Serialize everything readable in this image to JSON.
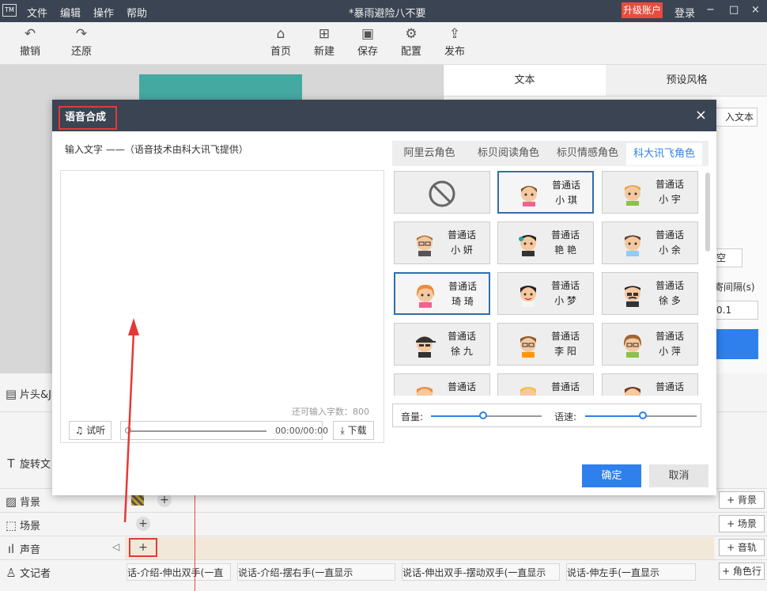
{
  "titlebar": {
    "logo": "TM",
    "menu": [
      "文件",
      "编辑",
      "操作",
      "帮助"
    ],
    "doc_title": "*暴雨避险八不要",
    "upgrade": "升级账户",
    "login": "登录",
    "window_controls": [
      "−",
      "□",
      "×"
    ]
  },
  "toolbar": {
    "undo": "撤销",
    "redo": "还原",
    "home": "首页",
    "new": "新建",
    "save": "保存",
    "config": "配置",
    "publish": "发布"
  },
  "right_panel": {
    "tab_text": "文本",
    "tab_preset": "预设风格",
    "import_partial": "入文本",
    "clear_partial": "空",
    "interval_partial": "寄间隔(s)",
    "interval_value": "0.1"
  },
  "timeline": {
    "header_partial": "片头&J",
    "rotate_partial": "旋转文",
    "rows": [
      {
        "label": "背景",
        "add": "+ 背景"
      },
      {
        "label": "场景",
        "add": "+ 场景"
      },
      {
        "label": "声音",
        "add": "+ 音轨"
      },
      {
        "label": "文记者",
        "add": "+ 角色行"
      }
    ],
    "clips": [
      "话-介绍-伸出双手(一直",
      "说话-介绍-摆右手(一直显示",
      "说话-伸出双手-摆动双手(一直显示",
      "说话-伸左手(一直显示"
    ]
  },
  "modal": {
    "title": "语音合成",
    "close": "×",
    "hint": "输入文字 ——（语音技术由科大讯飞提供）",
    "remaining": "还可输入字数：800",
    "listen": "试听",
    "time": "00:00/00:00",
    "download": "下载",
    "tabs": [
      "阿里云角色",
      "标贝阅读角色",
      "标贝情感角色",
      "科大讯飞角色"
    ],
    "active_tab": "科大讯飞角色",
    "voices": [
      {
        "line1": "",
        "line2": "",
        "type": "none"
      },
      {
        "line1": "普通话",
        "line2": "小 琪",
        "type": "girl"
      },
      {
        "line1": "普通话",
        "line2": "小 宇",
        "type": "boy"
      },
      {
        "line1": "普通话",
        "line2": "小 妍",
        "type": "woman-glasses"
      },
      {
        "line1": "普通话",
        "line2": "艳 艳",
        "type": "woman-mic"
      },
      {
        "line1": "普通话",
        "line2": "小 余",
        "type": "man-suit"
      },
      {
        "line1": "普通话",
        "line2": "琦 琦",
        "type": "girl2"
      },
      {
        "line1": "普通话",
        "line2": "小 梦",
        "type": "girl3"
      },
      {
        "line1": "普通话",
        "line2": "徐 多",
        "type": "man-mustache"
      },
      {
        "line1": "普通话",
        "line2": "徐 九",
        "type": "boy-cap"
      },
      {
        "line1": "普通话",
        "line2": "李 阳",
        "type": "boy2"
      },
      {
        "line1": "普通话",
        "line2": "小 萍",
        "type": "woman-glasses2"
      },
      {
        "line1": "普通话",
        "line2": "",
        "type": "boy3"
      },
      {
        "line1": "普通话",
        "line2": "",
        "type": "girl4"
      },
      {
        "line1": "普通话",
        "line2": "",
        "type": "girl5"
      }
    ],
    "volume_label": "音量:",
    "speed_label": "语速:",
    "volume_level": 0.47,
    "speed_level": 0.52,
    "ok": "确定",
    "cancel": "取消"
  },
  "colors": {
    "accent": "#2f80ed",
    "annotation_red": "#e53935",
    "header_dark": "#3a4452"
  }
}
